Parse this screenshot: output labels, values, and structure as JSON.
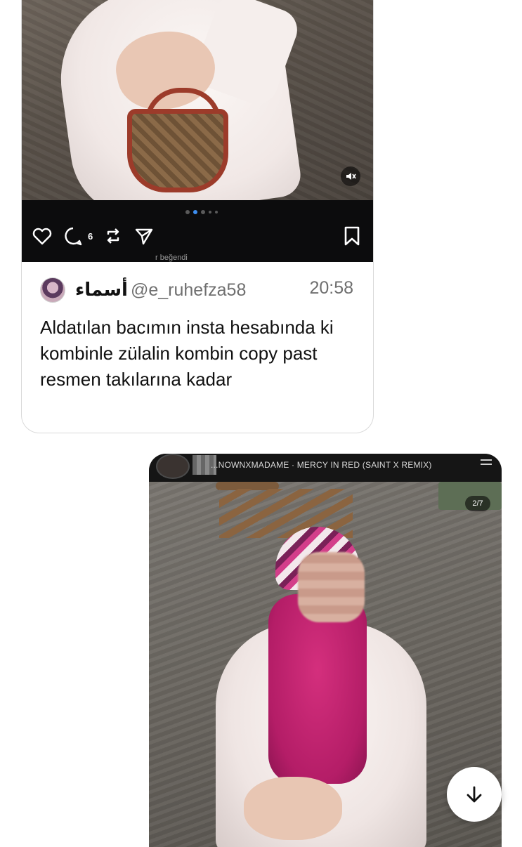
{
  "quoted_post": {
    "comment_count": "6",
    "liked_by_text": "r beğendi",
    "carousel_dots": 5,
    "carousel_active": 1
  },
  "tweet": {
    "author_name": "أسماء",
    "handle": "@e_ruhefza58",
    "time": "20:58",
    "text": "Aldatılan bacımın insta hesabında ki kombinle zülalin kombin copy past resmen takılarına kadar"
  },
  "story": {
    "music_title": "...NOWNXMADAME · MERCY IN RED (SAINT X REMIX)",
    "page_indicator": "2/7"
  },
  "icons": {
    "like": "heart-icon",
    "comment": "comment-icon",
    "repost": "repost-icon",
    "share": "send-icon",
    "save": "bookmark-icon",
    "mute": "muted-speaker-icon",
    "scroll": "arrow-down-icon"
  },
  "colors": {
    "ig_bar": "#0c0c0d",
    "active_dot": "#3d8ef0",
    "text_primary": "#111111",
    "text_secondary": "#6f6f6f"
  }
}
